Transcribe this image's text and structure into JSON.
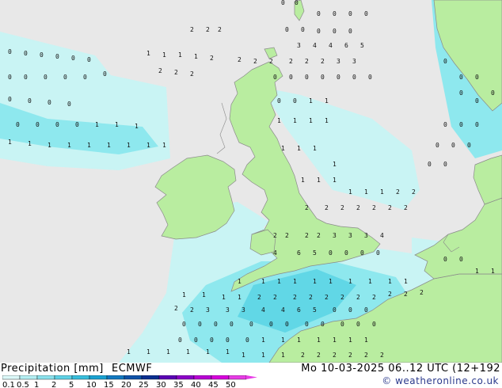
{
  "header": {
    "legend_title": "Precipitation [mm]",
    "model": "ECMWF",
    "valid_time": "Mo 10-03-2025 06..12 UTC (12+192",
    "credit": "© weatheronline.co.uk"
  },
  "colors": {
    "sea": "#e8e8e8",
    "land": "#b9eda0",
    "coast": "#8a8a8a",
    "precip_light": "#c9f4f4",
    "precip_mid": "#8ee8ee",
    "precip_heavy": "#3cc8e0",
    "value_text": "#111111"
  },
  "legend": {
    "ticks": [
      "0.1",
      "0.5",
      "1",
      "2",
      "5",
      "10",
      "15",
      "20",
      "25",
      "30",
      "35",
      "40",
      "45",
      "50"
    ],
    "colors": [
      "#dcf8f8",
      "#b4eef2",
      "#8be2ec",
      "#5fd2e6",
      "#38bedc",
      "#1aa2d2",
      "#1278c0",
      "#0e52a8",
      "#0a2e90",
      "#5a00b4",
      "#8c00c8",
      "#b800d4",
      "#d800dc",
      "#e83ce6"
    ]
  },
  "map_values": [
    "0",
    "0",
    "0",
    "0",
    "0",
    "0",
    "0",
    "0",
    "0",
    "0",
    "0",
    "0",
    "0",
    "0",
    "0",
    "0",
    "0",
    "0",
    "0",
    "0",
    "1",
    "1",
    "1",
    "1",
    "1",
    "1",
    "1",
    "1",
    "1",
    "1",
    "1",
    "1",
    "1",
    "1",
    "1",
    "1",
    "2",
    "2",
    "2",
    "2",
    "2",
    "2",
    "2",
    "2",
    "2",
    "2",
    "2",
    "2",
    "2",
    "3",
    "3",
    "3",
    "4",
    "4",
    "6",
    "5"
  ]
}
